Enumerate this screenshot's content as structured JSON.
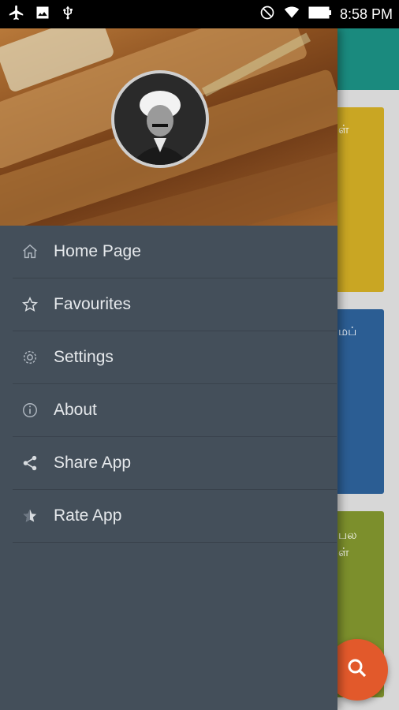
{
  "status_bar": {
    "time": "8:58 PM",
    "left_icons": [
      "airplane-icon",
      "image-icon",
      "usb-icon"
    ],
    "right_icons": [
      "do-not-disturb-icon",
      "wifi-icon",
      "battery-icon"
    ]
  },
  "drawer": {
    "menu": [
      {
        "label": "Home Page",
        "icon": "home-icon"
      },
      {
        "label": "Favourites",
        "icon": "star-icon"
      },
      {
        "label": "Settings",
        "icon": "gear-icon"
      },
      {
        "label": "About",
        "icon": "info-icon"
      },
      {
        "label": "Share App",
        "icon": "share-icon"
      },
      {
        "label": "Rate App",
        "icon": "rate-star-icon"
      }
    ]
  },
  "background": {
    "cards": [
      "ள்",
      "மப்",
      "பல\nள்"
    ],
    "fab_icon": "search-icon"
  },
  "colors": {
    "header": "#1a8a7e",
    "drawer": "#444f5a",
    "card1": "#c9a623",
    "card2": "#2b5d93",
    "card3": "#7c8f2c",
    "fab": "#e2592b"
  }
}
